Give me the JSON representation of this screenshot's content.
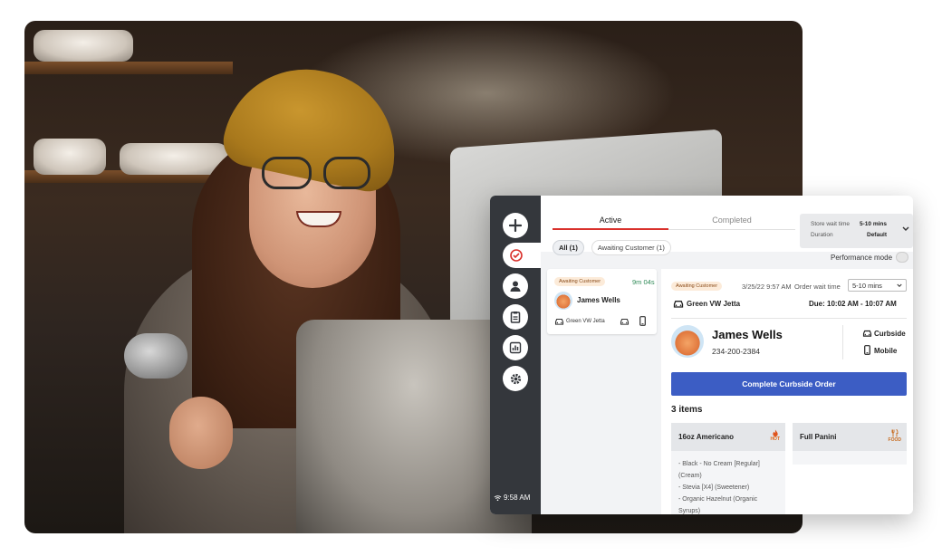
{
  "sidebar": {
    "time": "9:58 AM",
    "icons": [
      "plus-icon",
      "orders-check-icon",
      "customer-icon",
      "clipboard-icon",
      "report-chart-icon",
      "settings-gear-icon"
    ]
  },
  "tabs": {
    "active": "Active",
    "completed": "Completed"
  },
  "wait": {
    "store_label": "Store wait time",
    "store_value": "5-10 mins",
    "duration_label": "Duration",
    "duration_value": "Default"
  },
  "filters": {
    "all": "All (1)",
    "awaiting": "Awaiting Customer (1)"
  },
  "performance_mode": "Performance mode",
  "order_card": {
    "status": "Awaiting Customer",
    "elapsed": "9m 04s",
    "name": "James Wells",
    "vehicle": "Green VW Jetta"
  },
  "detail": {
    "status": "Awaiting Customer",
    "timestamp": "3/25/22 9:57 AM",
    "wait_label": "Order wait time",
    "wait_select": "5-10 mins",
    "vehicle": "Green VW Jetta",
    "due": "Due: 10:02 AM - 10:07 AM",
    "customer_name": "James Wells",
    "phone": "234-200-2384",
    "pickup": "Curbside",
    "channel": "Mobile",
    "complete_button": "Complete Curbside Order",
    "items_count": "3 items",
    "items": [
      {
        "name": "16oz Americano",
        "tag": "HOT",
        "modifiers": [
          "- Black - No Cream [Regular]",
          "(Cream)",
          "- Stevia [X4] (Sweetener)",
          "- Organic Hazelnut (Organic",
          "Syrups)"
        ]
      },
      {
        "name": "Full Panini",
        "tag": "FOOD",
        "modifiers": []
      }
    ]
  },
  "colors": {
    "accent_red": "#d9302b",
    "primary_blue": "#3c5dc4",
    "rail": "#34373c",
    "badge_bg": "#fcebd9"
  }
}
